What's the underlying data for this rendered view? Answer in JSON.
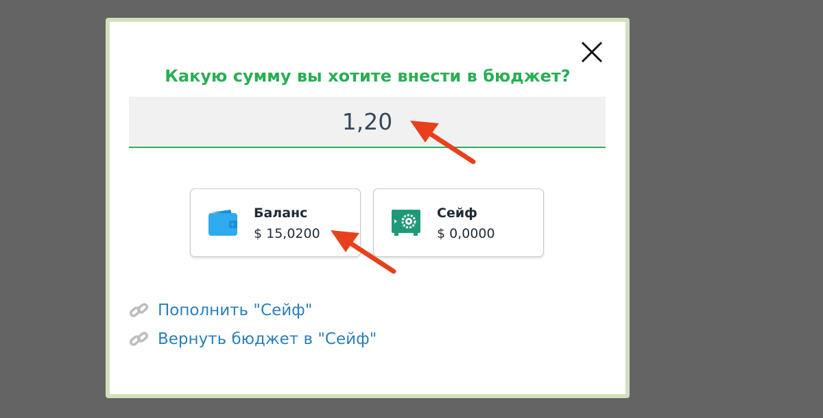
{
  "dialog": {
    "title": "Какую сумму вы хотите внести в бюджет?",
    "amount_value": "1,20",
    "close_icon": "close-icon"
  },
  "sources": [
    {
      "name": "Баланс",
      "amount": "$ 15,0200",
      "icon": "wallet-icon"
    },
    {
      "name": "Сейф",
      "amount": "$ 0,0000",
      "icon": "safe-icon"
    }
  ],
  "links": [
    {
      "label": "Пополнить \"Сейф\"",
      "icon": "link-icon"
    },
    {
      "label": "Вернуть бюджет в \"Сейф\"",
      "icon": "link-icon"
    }
  ],
  "colors": {
    "accent_green": "#2aae54",
    "link_blue": "#2a7fba",
    "annotation_arrow": "#e8401c",
    "overlay": "#646464"
  }
}
